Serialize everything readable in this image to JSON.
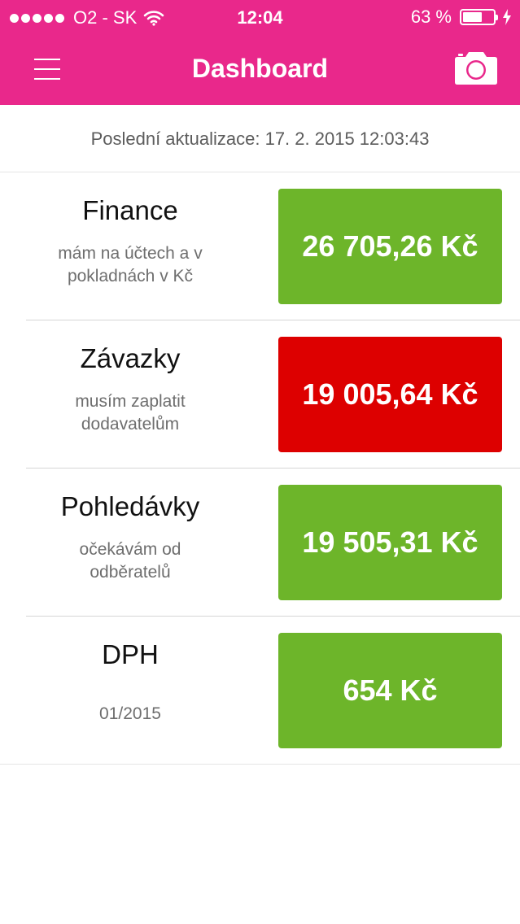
{
  "status_bar": {
    "carrier": "O2 - SK",
    "time": "12:04",
    "battery_percent": "63 %",
    "battery_level": 0.63,
    "icons": [
      "signal-dots-icon",
      "wifi-icon",
      "battery-icon",
      "charging-bolt-icon"
    ]
  },
  "nav": {
    "title": "Dashboard",
    "left_icon": "menu-icon",
    "right_icon": "camera-icon"
  },
  "last_update": "Poslední aktualizace: 17. 2. 2015 12:03:43",
  "rows": [
    {
      "title": "Finance",
      "subtitle": "mám na účtech a v pokladnách v Kč",
      "amount": "26 705,26 Kč",
      "color": "#6db52a"
    },
    {
      "title": "Závazky",
      "subtitle": "musím zaplatit dodavatelům",
      "amount": "19 005,64 Kč",
      "color": "#dd0000"
    },
    {
      "title": "Pohledávky",
      "subtitle": "očekávám od odběratelů",
      "amount": "19 505,31 Kč",
      "color": "#6db52a"
    },
    {
      "title": "DPH",
      "subtitle": "01/2015",
      "amount": "654 Kč",
      "color": "#6db52a"
    }
  ],
  "colors": {
    "header": "#e9288b",
    "positive": "#6db52a",
    "negative": "#dd0000"
  }
}
